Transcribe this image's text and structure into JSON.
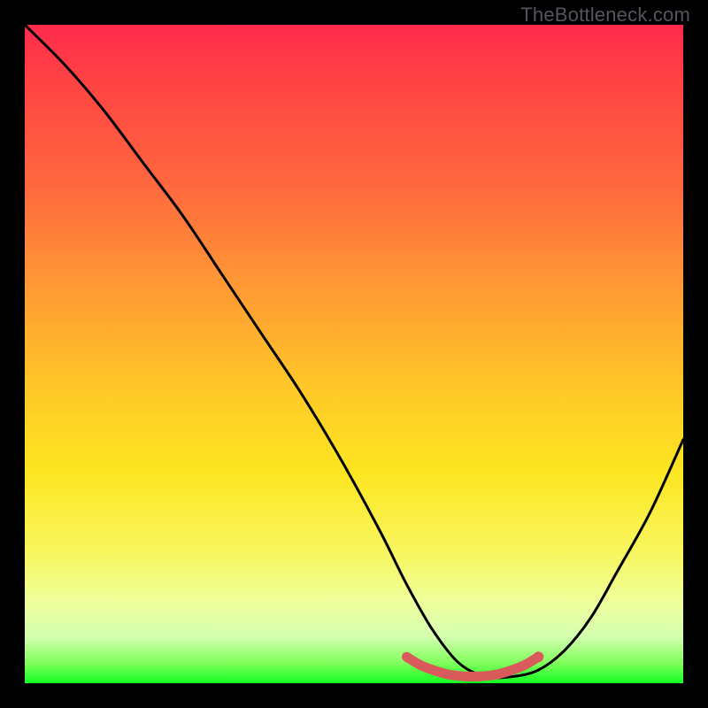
{
  "watermark": "TheBottleneck.com",
  "chart_data": {
    "type": "line",
    "title": "",
    "xlabel": "",
    "ylabel": "",
    "xlim": [
      0,
      100
    ],
    "ylim": [
      0,
      100
    ],
    "series": [
      {
        "name": "bottleneck-curve",
        "x": [
          0,
          6,
          12,
          18,
          24,
          30,
          36,
          42,
          48,
          54,
          58,
          62,
          66,
          70,
          74,
          78,
          82,
          86,
          90,
          95,
          100
        ],
        "y": [
          100,
          94,
          87,
          79,
          71,
          62,
          53,
          44,
          34,
          23,
          15,
          8,
          3,
          1,
          1,
          2,
          5,
          10,
          17,
          26,
          37
        ]
      }
    ],
    "highlight": {
      "name": "optimal-range",
      "x": [
        58,
        60,
        62,
        64,
        66,
        68,
        70,
        72,
        74,
        76,
        78
      ],
      "y": [
        4,
        2.8,
        2.0,
        1.4,
        1.1,
        1.0,
        1.1,
        1.4,
        2.0,
        2.8,
        4
      ]
    },
    "gradient_stops": [
      {
        "pos": 0,
        "color": "#ff2a4d"
      },
      {
        "pos": 25,
        "color": "#ff6a3e"
      },
      {
        "pos": 55,
        "color": "#ffc728"
      },
      {
        "pos": 80,
        "color": "#f8f65e"
      },
      {
        "pos": 100,
        "color": "#11ff22"
      }
    ]
  }
}
